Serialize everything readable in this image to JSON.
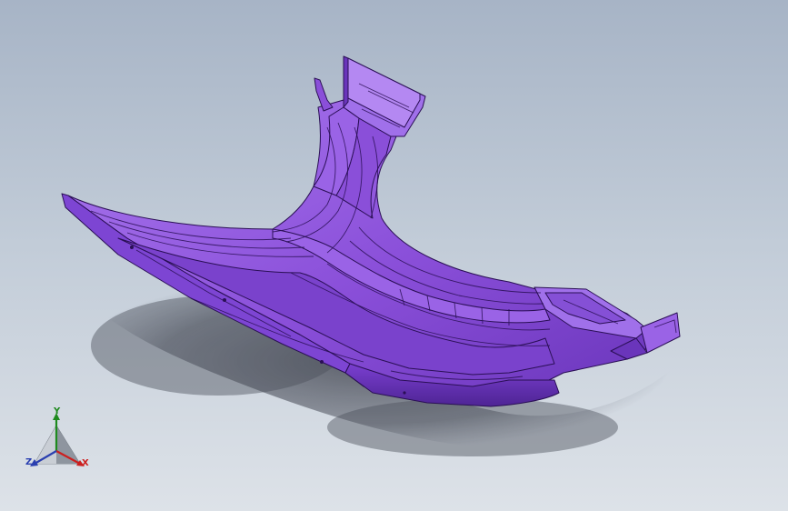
{
  "viewport": {
    "background_top": "#a7b4c6",
    "background_bottom": "#dde2e8"
  },
  "model": {
    "color": "#8a4fd9",
    "shade_light": "#a978ef",
    "shade_dark": "#5c2aa6",
    "edge_color": "#2a0f55"
  },
  "triad": {
    "x_label": "X",
    "y_label": "Y",
    "z_label": "Z",
    "x_color": "#cc1f1f",
    "y_color": "#1f8a1f",
    "z_color": "#2a3fb0"
  }
}
